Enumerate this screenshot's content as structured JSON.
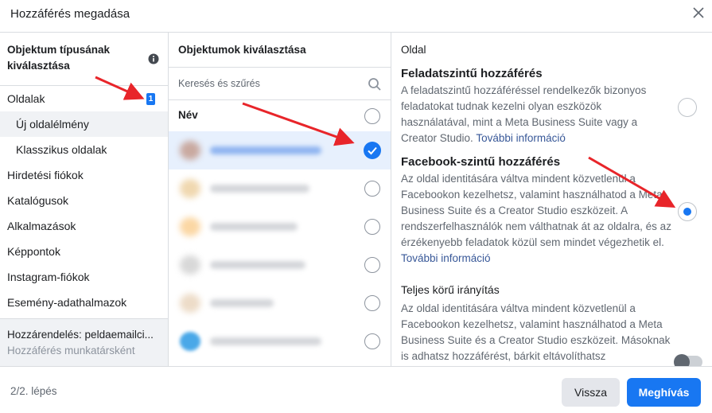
{
  "dialog": {
    "title": "Hozzáférés megadása",
    "close_icon": "close-icon"
  },
  "left": {
    "heading": "Objektum típusának kiválasztása",
    "info_icon": "info-icon",
    "items": [
      {
        "label": "Oldalak",
        "badge": "1"
      },
      {
        "label": "Új oldalélmény"
      },
      {
        "label": "Klasszikus oldalak"
      },
      {
        "label": "Hirdetési fiókok"
      },
      {
        "label": "Katalógusok"
      },
      {
        "label": "Alkalmazások"
      },
      {
        "label": "Képpontok"
      },
      {
        "label": "Instagram-fiókok"
      },
      {
        "label": "Esemény-adathalmazok"
      }
    ],
    "assign_line1": "Hozzárendelés: peldaemailci...",
    "assign_line2": "Hozzáférés munkatársként"
  },
  "middle": {
    "heading": "Objektumok kiválasztása",
    "search_placeholder": "Keresés és szűrés",
    "column_name": "Név"
  },
  "right": {
    "heading": "Oldal",
    "options": [
      {
        "title": "Feladatszintű hozzáférés",
        "desc": "A feladatszintű hozzáféréssel rendelkezők bizonyos feladatokat tudnak kezelni olyan eszközök használatával, mint a Meta Business Suite vagy a Creator Studio.",
        "link": "További információ"
      },
      {
        "title": "Facebook-szintű hozzáférés",
        "desc": "Az oldal identitására váltva mindent közvetlenül a Facebookon kezelhetsz, valamint használhatod a Meta Business Suite és a Creator Studio eszközeit. A rendszerfelhasználók nem válthatnak át az oldalra, és az érzékenyebb feladatok közül sem mindet végezhetik el.",
        "link": "További információ"
      },
      {
        "title": "Teljes körű irányítás",
        "desc": "Az oldal identitására váltva mindent közvetlenül a Facebookon kezelhetsz, valamint használhatod a Meta Business Suite és a Creator Studio eszközeit. Másoknak is adhatsz hozzáférést, bárkit eltávolíthatsz"
      }
    ]
  },
  "footer": {
    "step": "2/2. lépés",
    "back_label": "Vissza",
    "grant_label": "Meghívás"
  },
  "colors": {
    "accent": "#1877f2",
    "arrow": "#e8252a"
  }
}
